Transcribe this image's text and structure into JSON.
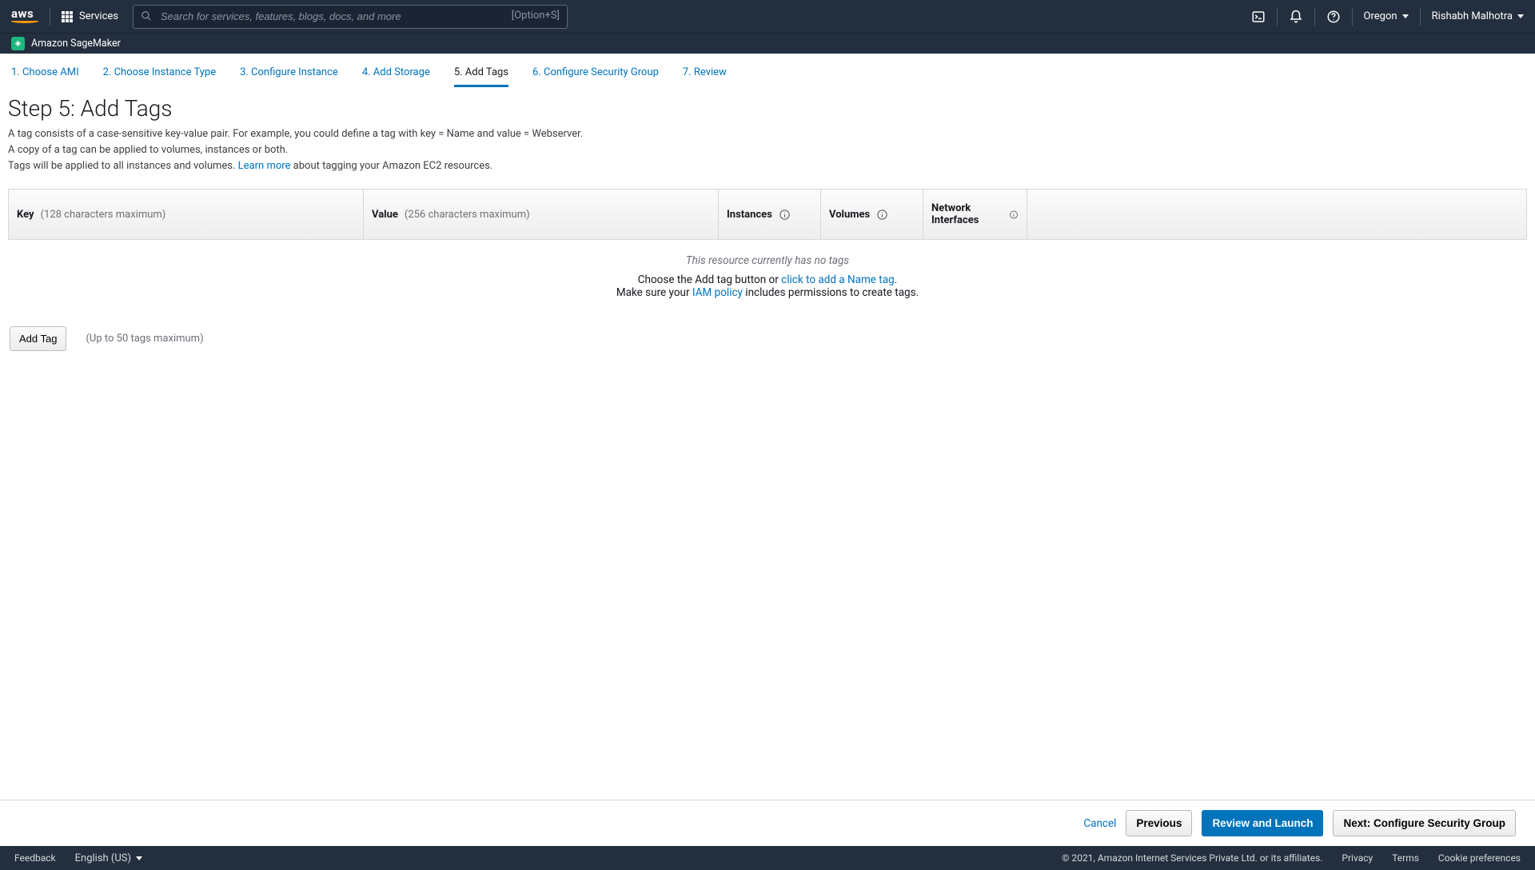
{
  "header": {
    "services_label": "Services",
    "search_placeholder": "Search for services, features, blogs, docs, and more",
    "search_shortcut": "[Option+S]",
    "region": "Oregon",
    "user": "Rishabh Malhotra"
  },
  "subnav": {
    "service": "Amazon SageMaker"
  },
  "steps": [
    {
      "label": "1. Choose AMI"
    },
    {
      "label": "2. Choose Instance Type"
    },
    {
      "label": "3. Configure Instance"
    },
    {
      "label": "4. Add Storage"
    },
    {
      "label": "5. Add Tags",
      "active": true
    },
    {
      "label": "6. Configure Security Group"
    },
    {
      "label": "7. Review"
    }
  ],
  "page": {
    "title": "Step 5: Add Tags",
    "desc1": "A tag consists of a case-sensitive key-value pair. For example, you could define a tag with key = Name and value = Webserver.",
    "desc2": "A copy of a tag can be applied to volumes, instances or both.",
    "desc3a": "Tags will be applied to all instances and volumes. ",
    "learn_more": "Learn more",
    "desc3b": " about tagging your Amazon EC2 resources."
  },
  "table": {
    "key_label": "Key",
    "key_hint": "(128 characters maximum)",
    "value_label": "Value",
    "value_hint": "(256 characters maximum)",
    "instances_label": "Instances",
    "volumes_label": "Volumes",
    "netif_label": "Network Interfaces"
  },
  "empty": {
    "no_tags": "This resource currently has no tags",
    "pre_link": "Choose the Add tag button or ",
    "name_tag_link": "click to add a Name tag",
    "post_link": ".",
    "iam_pre": "Make sure your ",
    "iam_link": "IAM policy",
    "iam_post": " includes permissions to create tags."
  },
  "add": {
    "button": "Add Tag",
    "limit": "(Up to 50 tags maximum)"
  },
  "wizfooter": {
    "cancel": "Cancel",
    "previous": "Previous",
    "review": "Review and Launch",
    "next": "Next: Configure Security Group"
  },
  "footer": {
    "feedback": "Feedback",
    "language": "English (US)",
    "copyright": "© 2021, Amazon Internet Services Private Ltd. or its affiliates.",
    "privacy": "Privacy",
    "terms": "Terms",
    "cookies": "Cookie preferences"
  }
}
